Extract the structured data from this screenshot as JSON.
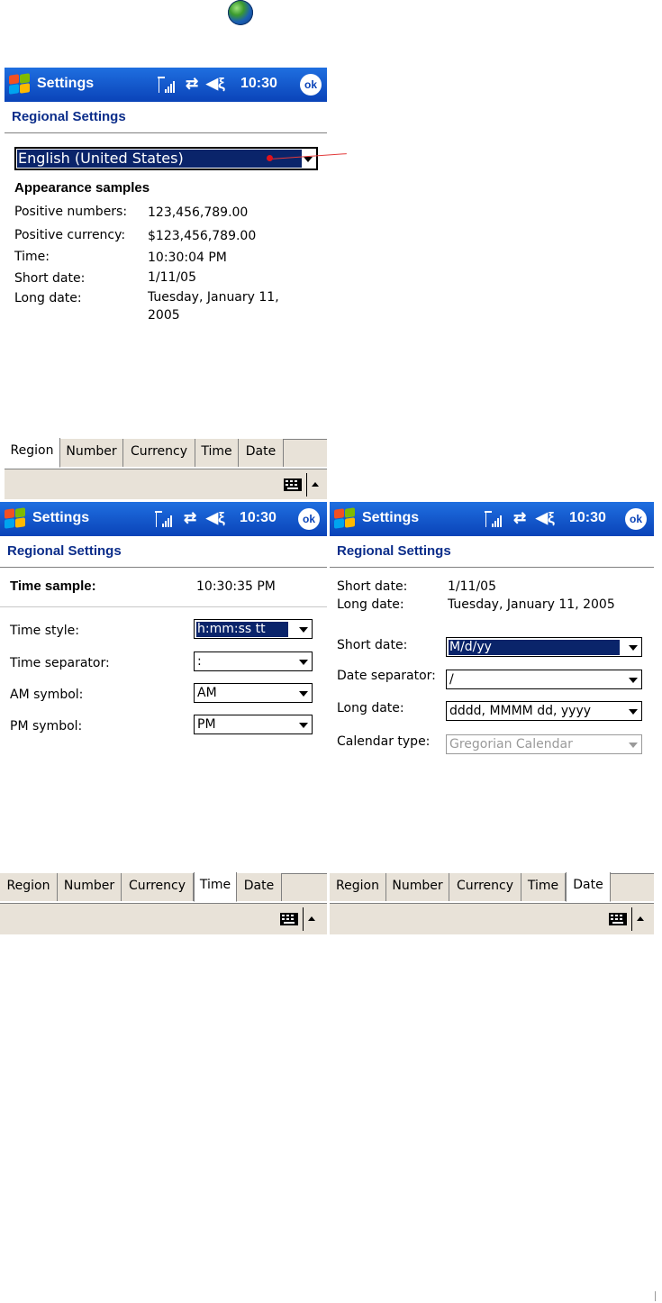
{
  "screens": [
    {
      "app_title": "Settings",
      "clock": "10:30",
      "ok_label": "ok",
      "page_title": "Regional Settings",
      "region_select": "English (United States)",
      "samples_heading": "Appearance samples",
      "samples": [
        {
          "label": "Positive numbers:",
          "value": "123,456,789.00"
        },
        {
          "label": "Positive currency:",
          "value": "$123,456,789.00"
        },
        {
          "label": "Time:",
          "value": "10:30:04 PM"
        },
        {
          "label": "Short date:",
          "value": "1/11/05"
        },
        {
          "label": "Long date:",
          "value_line1": "Tuesday, January 11,",
          "value_line2": "2005"
        }
      ],
      "tabs": [
        "Region",
        "Number",
        "Currency",
        "Time",
        "Date"
      ],
      "active_tab": "Region"
    },
    {
      "app_title": "Settings",
      "clock": "10:30",
      "ok_label": "ok",
      "page_title": "Regional Settings",
      "sample_label": "Time sample:",
      "sample_value": "10:30:35 PM",
      "fields": [
        {
          "label": "Time style:",
          "value": "h:mm:ss tt",
          "selected": true
        },
        {
          "label": "Time separator:",
          "value": ":"
        },
        {
          "label": "AM symbol:",
          "value": "AM"
        },
        {
          "label": "PM symbol:",
          "value": "PM"
        }
      ],
      "tabs": [
        "Region",
        "Number",
        "Currency",
        "Time",
        "Date"
      ],
      "active_tab": "Time"
    },
    {
      "app_title": "Settings",
      "clock": "10:30",
      "ok_label": "ok",
      "page_title": "Regional Settings",
      "samples": [
        {
          "label": "Short date:",
          "value": "1/11/05"
        },
        {
          "label": "Long date:",
          "value": "Tuesday, January 11, 2005"
        }
      ],
      "fields": [
        {
          "label": "Short date:",
          "value": "M/d/yy",
          "selected": true
        },
        {
          "label": "Date separator:",
          "value": "/"
        },
        {
          "label": "Long date:",
          "value": "dddd, MMMM dd, yyyy"
        },
        {
          "label": "Calendar type:",
          "value": "Gregorian Calendar",
          "disabled": true
        }
      ],
      "tabs": [
        "Region",
        "Number",
        "Currency",
        "Time",
        "Date"
      ],
      "active_tab": "Date"
    }
  ],
  "icons": [
    "globe-icon",
    "windows-start-icon",
    "signal-icon",
    "sync-icon",
    "speaker-muted-icon",
    "keyboard-icon",
    "sip-arrow-icon"
  ],
  "colors": {
    "title_bar": "#0a43b8",
    "selection": "#0a246a",
    "header_text": "#0b2d8a",
    "tab_bar": "#e8e2d8",
    "callout": "#e0121b"
  }
}
